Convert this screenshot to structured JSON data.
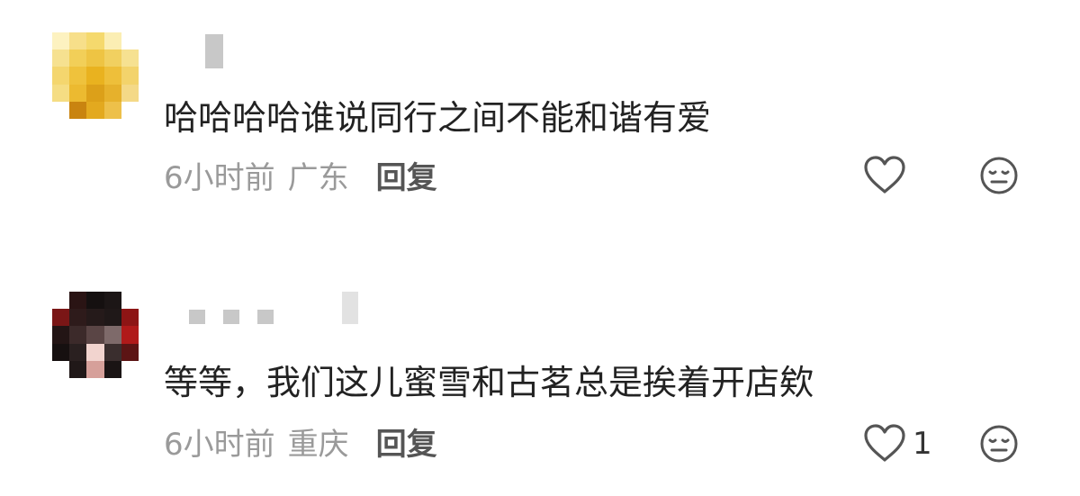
{
  "comments": [
    {
      "text": "哈哈哈哈谁说同行之间不能和谐有爱",
      "time": "6小时前",
      "location": "广东",
      "reply_label": "回复",
      "like_count": "",
      "like_icon": "heart-outline-icon",
      "dislike_icon": "meh-face-icon",
      "avatar_colors": [
        "#fdf2c0",
        "#f7df8a",
        "#f5d96d",
        "#fbeeb3",
        "#ffffff",
        "#f6e190",
        "#f2cf58",
        "#eec443",
        "#f1d060",
        "#f6e191",
        "#f4d66e",
        "#efc23c",
        "#e9b21f",
        "#eebf3a",
        "#f3d36b",
        "#f5dd83",
        "#ecba30",
        "#dca019",
        "#e6b12c",
        "#f4d987",
        "#ffffff",
        "#c98410",
        "#e3a91f",
        "#edc04a",
        "#ffffff"
      ]
    },
    {
      "text": "等等，我们这儿蜜雪和古茗总是挨着开店欸",
      "time": "6小时前",
      "location": "重庆",
      "reply_label": "回复",
      "like_count": "1",
      "like_icon": "heart-outline-icon",
      "dislike_icon": "meh-face-icon",
      "avatar_colors": [
        "#ffffff",
        "#2a1414",
        "#151010",
        "#1c1616",
        "#ffffff",
        "#7a1616",
        "#2e1b1b",
        "#251a1a",
        "#1f1818",
        "#8d1515",
        "#231515",
        "#3c2a2a",
        "#5a4545",
        "#7e6a6a",
        "#b01a1a",
        "#161010",
        "#2a2020",
        "#f2d4cf",
        "#3a2e2e",
        "#5c1414",
        "#ffffff",
        "#201818",
        "#d6a09a",
        "#1a1414",
        "#ffffff"
      ]
    }
  ],
  "colors": {
    "text": "#222222",
    "meta": "#9a9a9a",
    "reply": "#555555",
    "icon": "#555555",
    "username_blur": "#c8c8c8"
  }
}
